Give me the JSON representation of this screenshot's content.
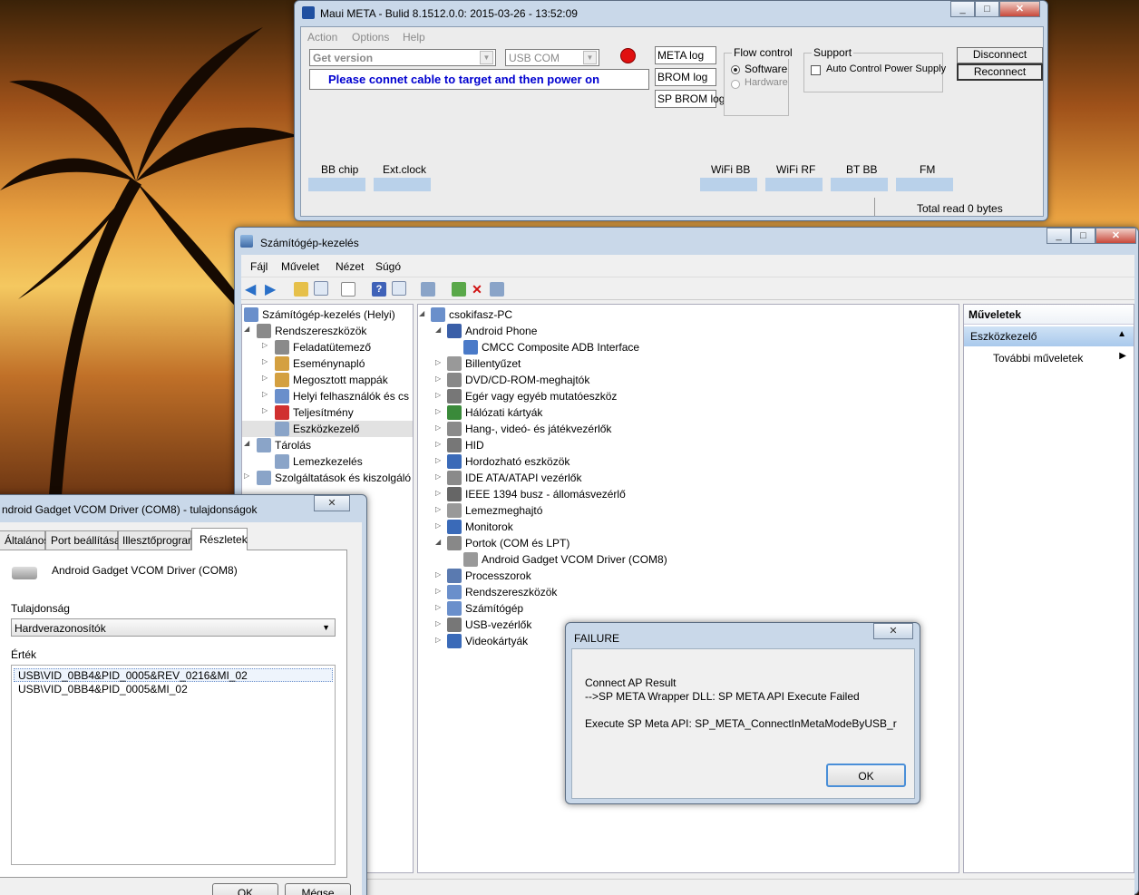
{
  "meta": {
    "title": "Maui META - Bulid 8.1512.0.0: 2015-03-26 - 13:52:09",
    "menu": [
      "Action",
      "Options",
      "Help"
    ],
    "action_select": "Get version",
    "port_select": "USB COM",
    "status_text": "Please connet cable to target and then power on",
    "logs": [
      "META log",
      "BROM log",
      "SP BROM log"
    ],
    "flow_control": {
      "label": "Flow control",
      "options": [
        "Software",
        "Hardware"
      ],
      "selected": "Software"
    },
    "support": {
      "label": "Support",
      "checkbox": "Auto Control Power Supply"
    },
    "disconnect": "Disconnect",
    "reconnect": "Reconnect",
    "info_labels": [
      "BB chip",
      "Ext.clock",
      "WiFi BB",
      "WiFi RF",
      "BT BB",
      "FM"
    ],
    "total_read": "Total read 0 bytes",
    "status_dot_color": "#e01010"
  },
  "cm": {
    "title": "Számítógép-kezelés",
    "menu": [
      "Fájl",
      "Művelet",
      "Nézet",
      "Súgó"
    ],
    "tree": [
      {
        "label": "Számítógép-kezelés (Helyi)"
      },
      {
        "label": "Rendszereszközök"
      },
      {
        "label": "Feladatütemező"
      },
      {
        "label": "Eseménynapló"
      },
      {
        "label": "Megosztott mappák"
      },
      {
        "label": "Helyi felhasználók és cs"
      },
      {
        "label": "Teljesítmény"
      },
      {
        "label": "Eszközkezelő"
      },
      {
        "label": "Tárolás"
      },
      {
        "label": "Lemezkezelés"
      },
      {
        "label": "Szolgáltatások és kiszolgáló"
      }
    ],
    "devices": [
      {
        "label": "csokifasz-PC"
      },
      {
        "label": "Android Phone"
      },
      {
        "label": "CMCC Composite ADB Interface"
      },
      {
        "label": "Billentyűzet"
      },
      {
        "label": "DVD/CD-ROM-meghajtók"
      },
      {
        "label": "Egér vagy egyéb mutatóeszköz"
      },
      {
        "label": "Hálózati kártyák"
      },
      {
        "label": "Hang-, videó- és játékvezérlők"
      },
      {
        "label": "HID"
      },
      {
        "label": "Hordozható eszközök"
      },
      {
        "label": "IDE ATA/ATAPI vezérlők"
      },
      {
        "label": "IEEE 1394 busz - állomásvezérlő"
      },
      {
        "label": "Lemezmeghajtó"
      },
      {
        "label": "Monitorok"
      },
      {
        "label": "Portok (COM és LPT)"
      },
      {
        "label": "Android Gadget VCOM Driver (COM8)"
      },
      {
        "label": "Processzorok"
      },
      {
        "label": "Rendszereszközök"
      },
      {
        "label": "Számítógép"
      },
      {
        "label": "USB-vezérlők"
      },
      {
        "label": "Videokártyák"
      }
    ],
    "actions": {
      "header": "Műveletek",
      "section": "Eszközkezelő",
      "more": "További műveletek"
    }
  },
  "props": {
    "title": "ndroid Gadget VCOM Driver (COM8) - tulajdonságok",
    "tabs": [
      "Általános",
      "Port beállítása",
      "Illesztőprogram",
      "Részletek"
    ],
    "active_tab": "Részletek",
    "device_name": "Android Gadget VCOM Driver (COM8)",
    "property_label": "Tulajdonság",
    "property_value": "Hardverazonosítók",
    "value_label": "Érték",
    "values": [
      "USB\\VID_0BB4&PID_0005&REV_0216&MI_02",
      "USB\\VID_0BB4&PID_0005&MI_02"
    ],
    "ok": "OK",
    "cancel": "Mégse"
  },
  "failure": {
    "title": "FAILURE",
    "line1": "Connect AP Result",
    "line2": "-->SP META Wrapper DLL: SP META API Execute Failed",
    "line3": "Execute SP Meta API: SP_META_ConnectInMetaModeByUSB_r",
    "ok": "OK"
  }
}
